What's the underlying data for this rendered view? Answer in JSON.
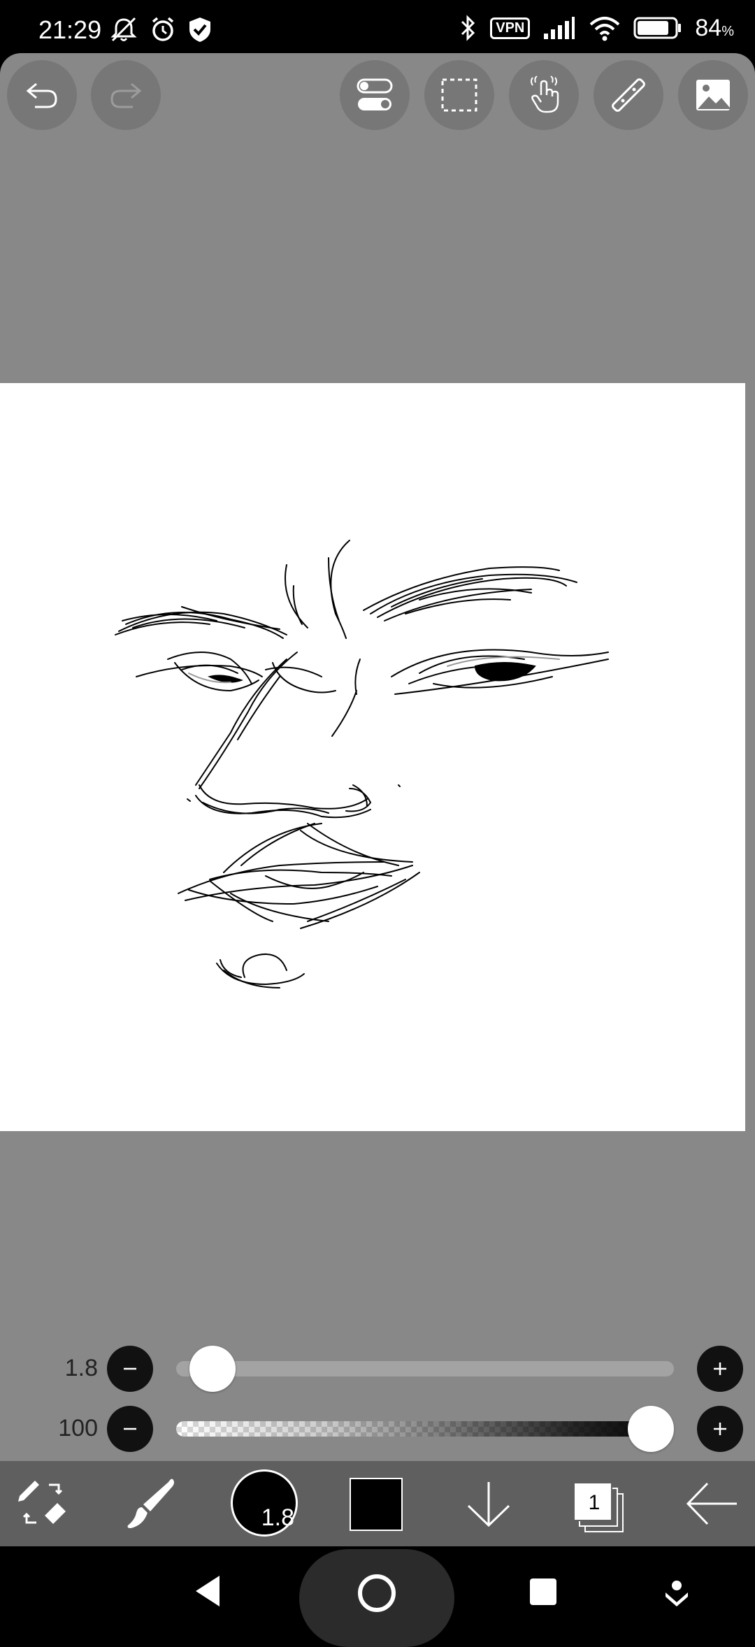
{
  "status_bar": {
    "time": "21:29",
    "vpn_label": "VPN",
    "battery_percent": "84",
    "battery_unit": "%",
    "battery_level": 0.84
  },
  "top_toolbar": {
    "icons": [
      "undo-icon",
      "redo-icon",
      "toggle-icon",
      "selection-icon",
      "hand-gesture-icon",
      "ruler-icon",
      "image-icon"
    ]
  },
  "sliders": {
    "brush_size": {
      "value": "1.8",
      "position": 0.03
    },
    "opacity": {
      "value": "100",
      "position": 1.0
    }
  },
  "bottom_toolbar": {
    "brush_size_label": "1.8",
    "current_color": "#000000",
    "layer_count": "1"
  },
  "colors": {
    "app_background": "#888888",
    "toolbar_background": "#5f5f5f",
    "canvas": "#ffffff"
  }
}
